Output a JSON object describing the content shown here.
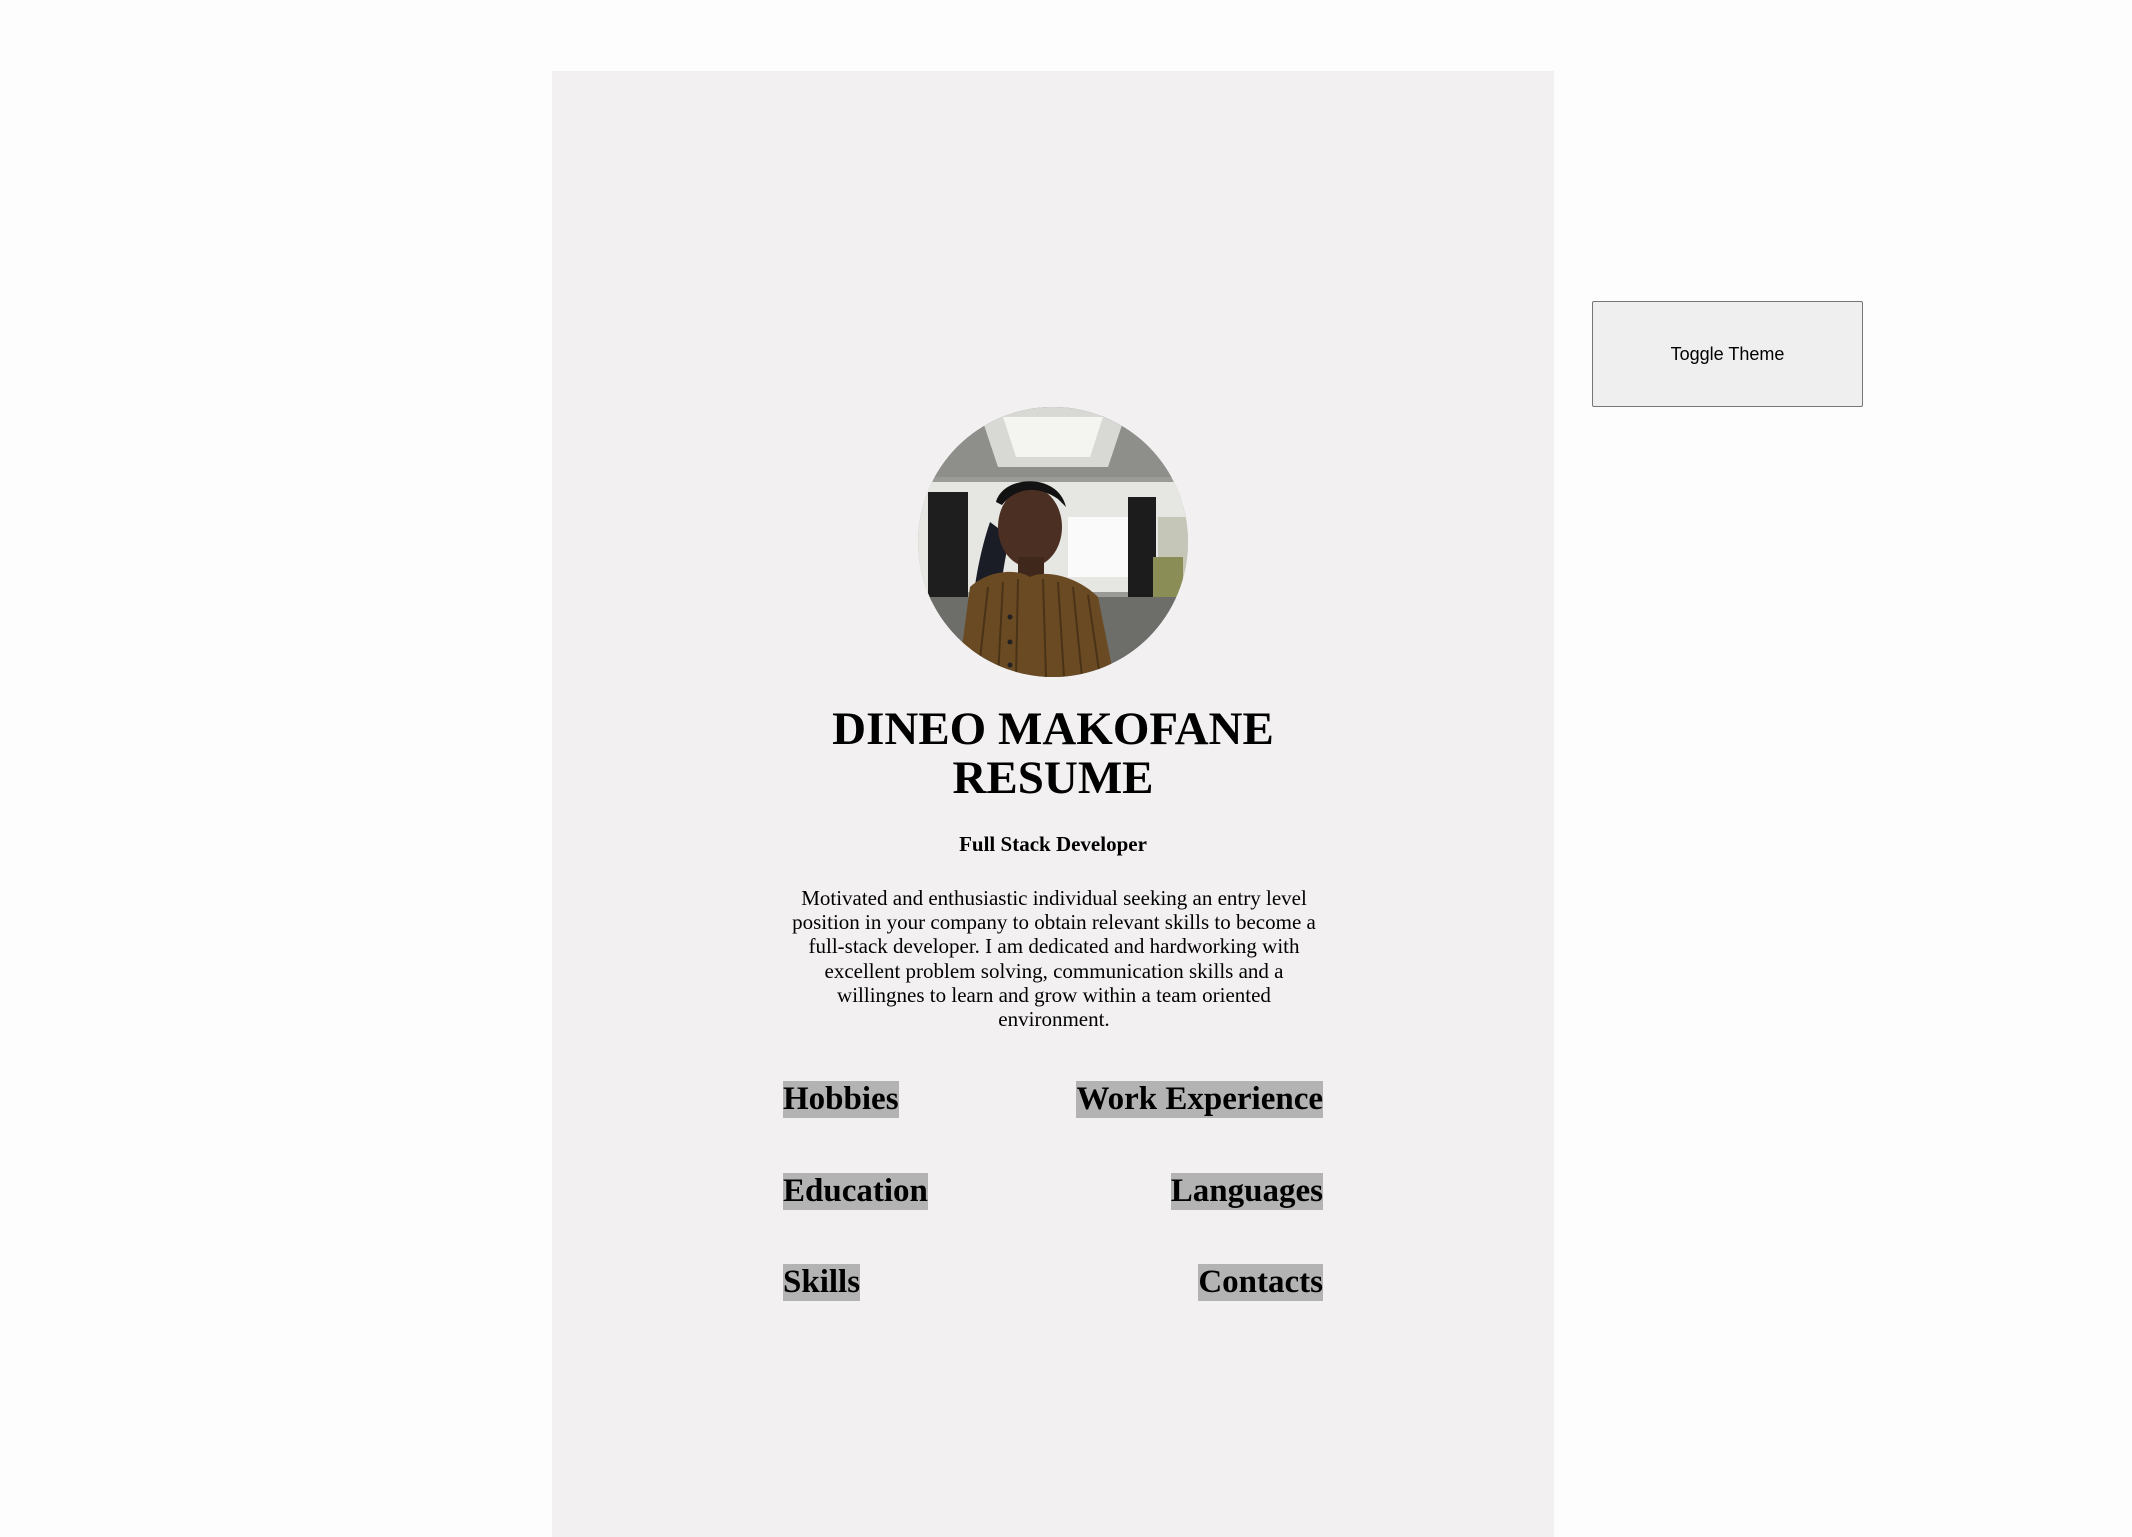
{
  "resume": {
    "title_line1": "DINEO MAKOFANE",
    "title_line2": "RESUME",
    "subtitle": "Full Stack Developer",
    "summary": "Motivated and enthusiastic individual seeking an entry level position in your company to obtain relevant skills to become a full-stack developer. I am dedicated and hardworking with excellent problem solving, communication skills and a willingnes to learn and grow within a team oriented environment.",
    "sections": {
      "hobbies": "Hobbies",
      "work_experience": "Work Experience",
      "education": "Education",
      "languages": "Languages",
      "skills": "Skills",
      "contacts": "Contacts"
    }
  },
  "controls": {
    "toggle_theme_label": "Toggle Theme"
  },
  "colors": {
    "card_background": "#f2f0f1",
    "heading_highlight": "#b3b3b3",
    "page_background": "#fdfdfd"
  }
}
